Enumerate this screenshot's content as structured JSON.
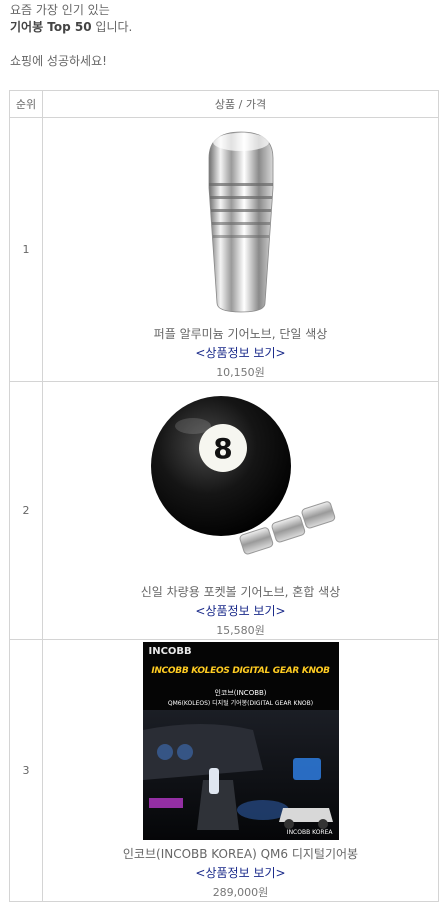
{
  "intro": {
    "line1": "요즘 가장 인기 있는",
    "line2_bold": "기어봉 Top 50",
    "line2_rest": " 입니다.",
    "line3": "쇼핑에 성공하세요!"
  },
  "table": {
    "header_rank": "순위",
    "header_product": "상품 / 가격",
    "rows": [
      {
        "rank": "1",
        "name": "퍼플 알루미늄 기어노브, 단일 색상",
        "link": "<상품정보 보기>",
        "price": "10,150원"
      },
      {
        "rank": "2",
        "name": "신일 차량용 포켓볼 기어노브, 혼합 색상",
        "link": "<상품정보 보기>",
        "price": "15,580원"
      },
      {
        "rank": "3",
        "name": "인코브(INCOBB KOREA) QM6 디지털기어봉",
        "link": "<상품정보 보기>",
        "price": "289,000원"
      }
    ]
  },
  "banner": {
    "brand": "INCOBB",
    "headline": "INCOBB KOLEOS DIGITAL GEAR KNOB",
    "sub1": "인코브(INCOBB)",
    "sub2": "QM6(KOLEOS) 디지털 기어봉(DIGITAL GEAR KNOB)",
    "corner": "INCOBB KOREA"
  }
}
